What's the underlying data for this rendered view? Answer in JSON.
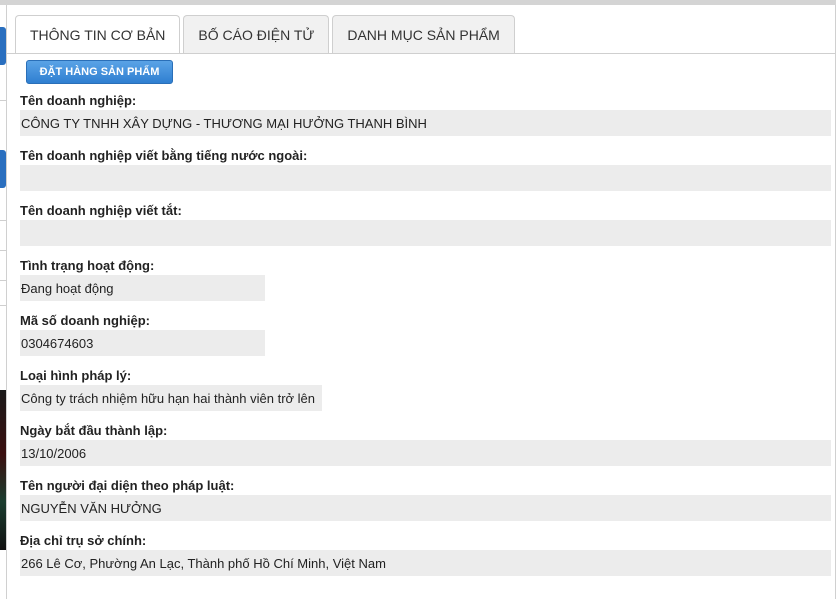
{
  "tabs": [
    {
      "label": "THÔNG TIN CƠ BẢN",
      "active": true
    },
    {
      "label": "BỐ CÁO ĐIỆN TỬ",
      "active": false
    },
    {
      "label": "DANH MỤC SẢN PHẨM",
      "active": false
    }
  ],
  "order_button": "ĐẶT HÀNG SẢN PHẨM",
  "fields": [
    {
      "label": "Tên doanh nghiệp:",
      "value": "CÔNG TY TNHH XÂY DỰNG - THƯƠNG MẠI HƯỞNG THANH BÌNH"
    },
    {
      "label": "Tên doanh nghiệp viết bằng tiếng nước ngoài:",
      "value": ""
    },
    {
      "label": "Tên doanh nghiệp viết tắt:",
      "value": ""
    },
    {
      "label": "Tình trạng hoạt động:",
      "value": "Đang hoạt động"
    },
    {
      "label": "Mã số doanh nghiệp:",
      "value": "0304674603"
    },
    {
      "label": "Loại hình pháp lý:",
      "value": "Công ty trách nhiệm hữu hạn hai thành viên trở lên"
    },
    {
      "label": "Ngày bắt đầu thành lập:",
      "value": "13/10/2006"
    },
    {
      "label": "Tên người đại diện theo pháp luật:",
      "value": "NGUYỄN VĂN HƯỞNG"
    },
    {
      "label": "Địa chỉ trụ sở chính:",
      "value": "266 Lê Cơ, Phường An Lạc, Thành phố Hồ Chí Minh, Việt Nam"
    }
  ],
  "colors": {
    "accent": "#2f7fd1",
    "value_bg": "#ececec"
  }
}
